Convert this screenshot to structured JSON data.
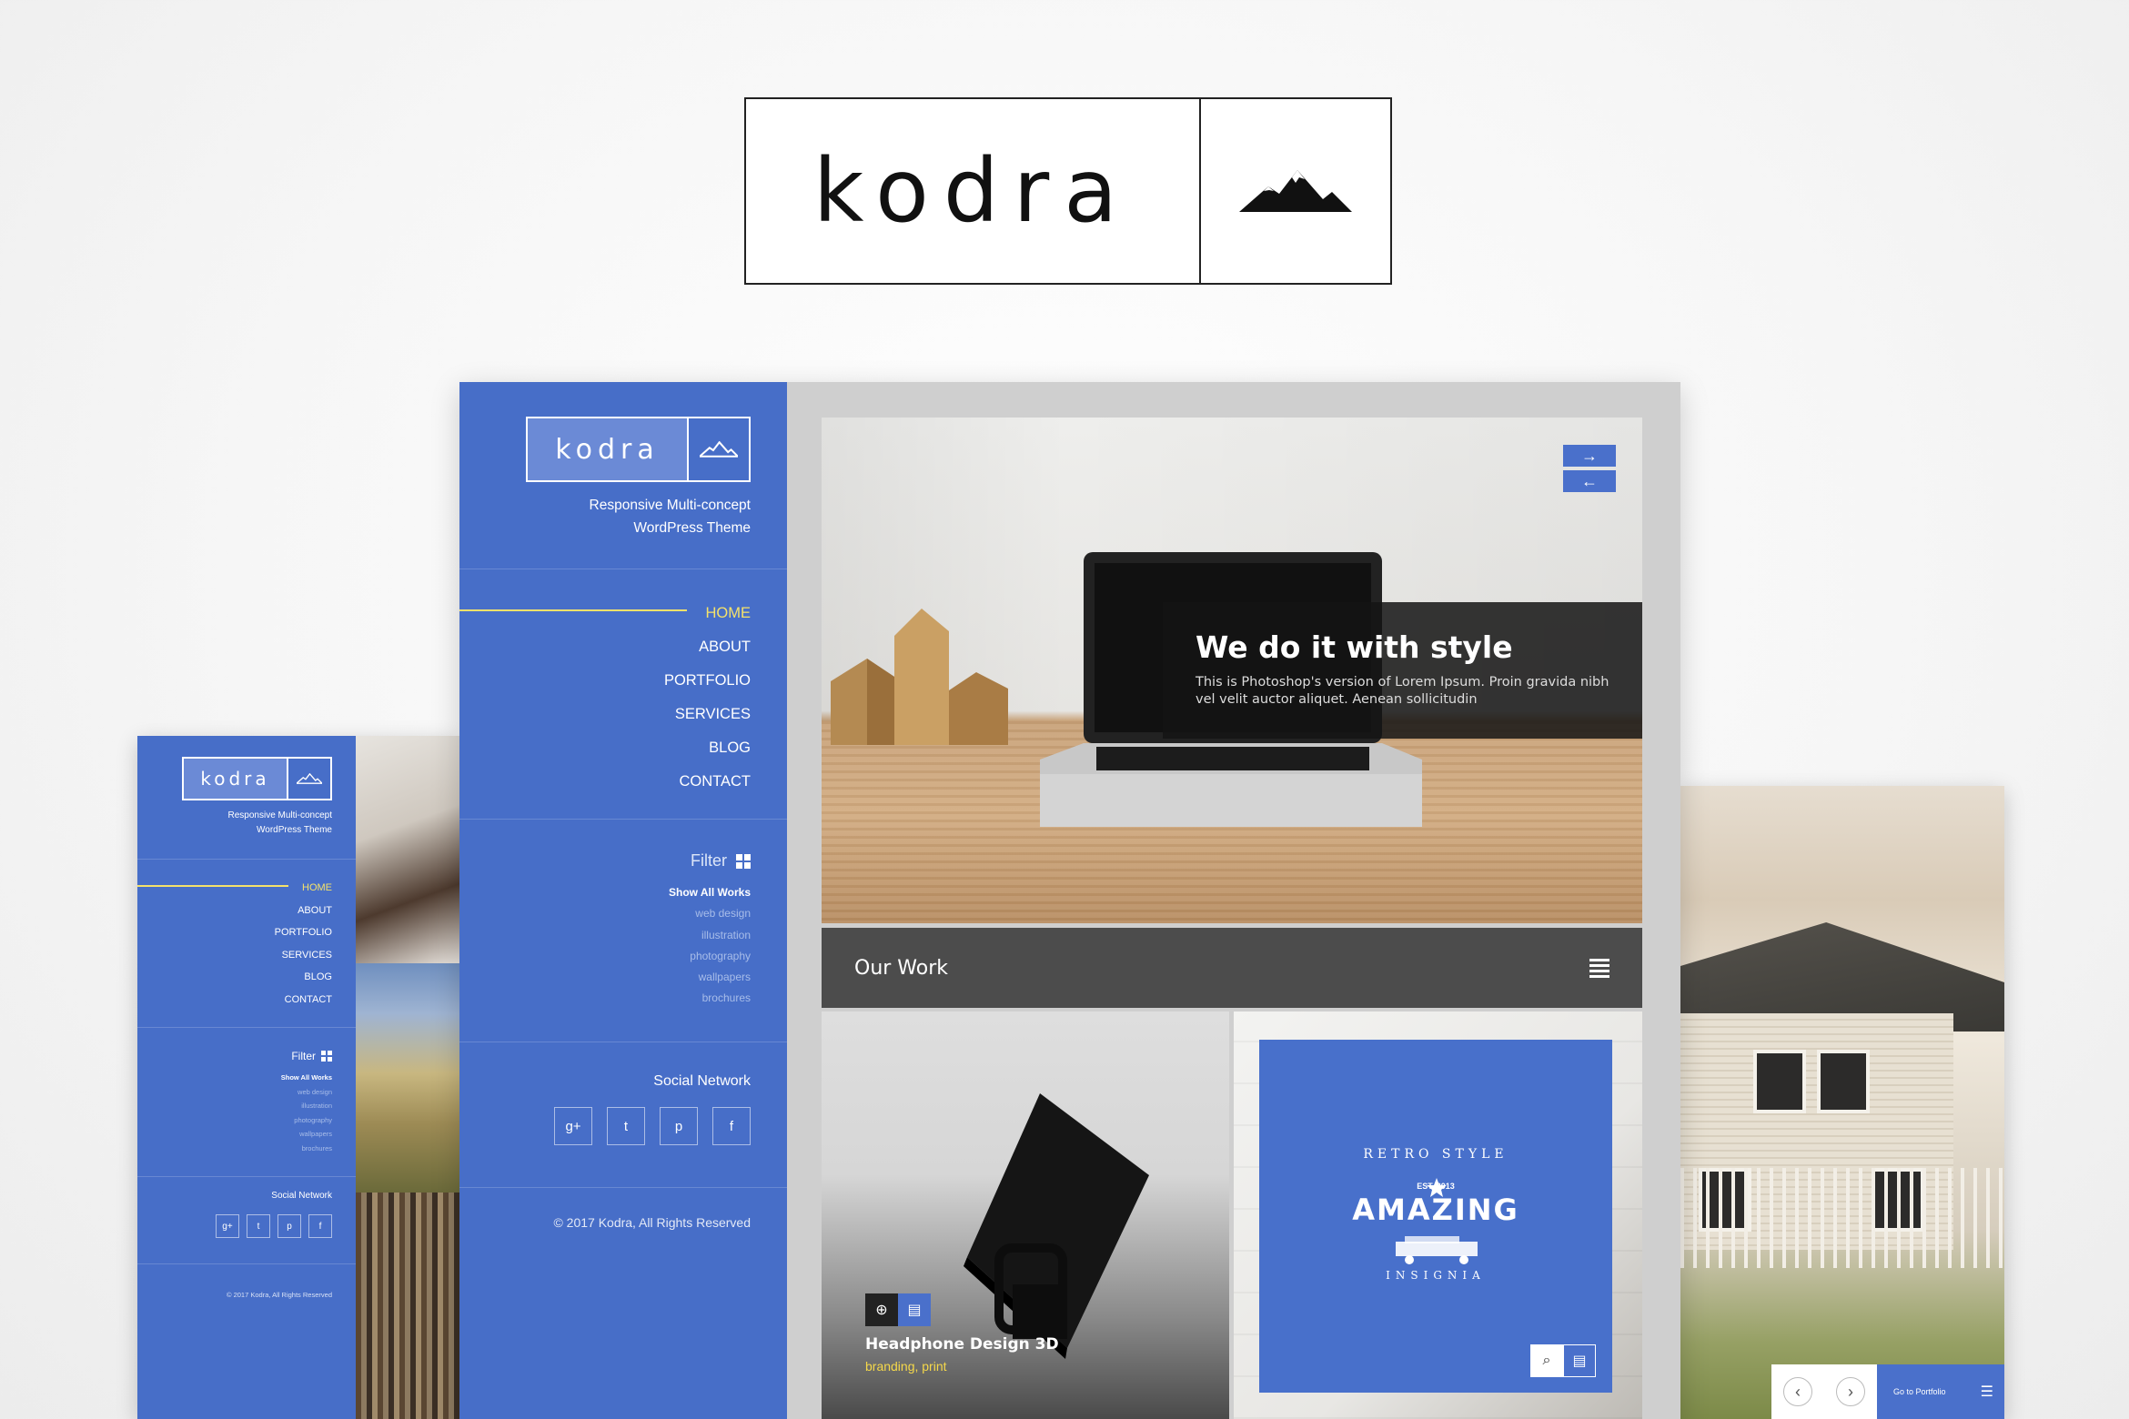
{
  "brand": {
    "name": "kodra",
    "tagline_line1": "Responsive Multi-concept",
    "tagline_line2": "WordPress Theme"
  },
  "nav": {
    "items": [
      "HOME",
      "ABOUT",
      "PORTFOLIO",
      "SERVICES",
      "BLOG",
      "CONTACT"
    ],
    "active": "HOME"
  },
  "filter": {
    "label": "Filter",
    "items": [
      "Show All Works",
      "web design",
      "illustration",
      "photography",
      "wallpapers",
      "brochures"
    ]
  },
  "social": {
    "label": "Social Network",
    "icons": [
      "google-plus-icon",
      "twitter-icon",
      "pinterest-icon",
      "facebook-icon"
    ],
    "glyphs": [
      "g+",
      "t",
      "p",
      "f"
    ]
  },
  "footer": {
    "copyright": "© 2017 Kodra, All Rights Reserved"
  },
  "hero": {
    "title": "We do it with style",
    "subtitle_line1": "This is Photoshop's version of Lorem Ipsum. Proin gravida nibh",
    "subtitle_line2": "vel velit auctor aliquet. Aenean sollicitudin"
  },
  "section": {
    "title": "Our Work"
  },
  "cards": [
    {
      "title": "Headphone Design 3D",
      "tags": "branding, print"
    }
  ],
  "poster": {
    "top": "RETRO STYLE",
    "est": "EST. 2013",
    "main": "AMAZING",
    "bottom": "INSIGNIA"
  },
  "right_screen": {
    "go_label": "Go to Portfolio"
  },
  "colors": {
    "accent": "#476ec8",
    "active_nav": "#f5e26a",
    "dark_bar": "#4c4c4c"
  }
}
